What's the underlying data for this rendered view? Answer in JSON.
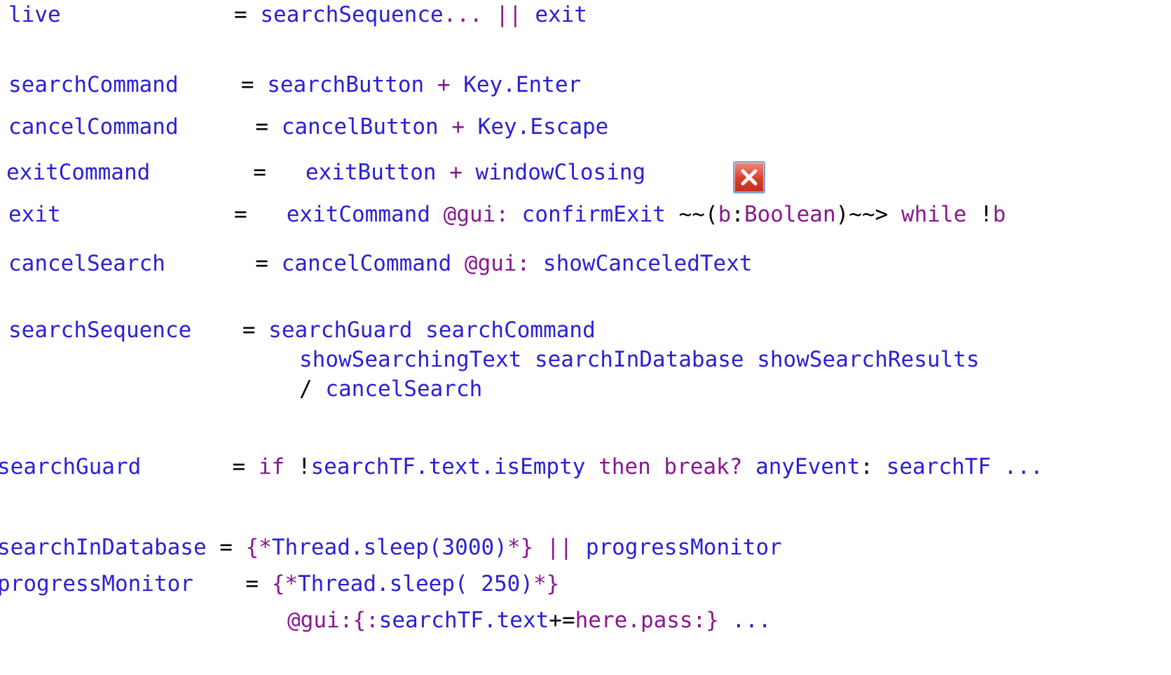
{
  "code_lines": [
    [
      {
        "t": "live",
        "k": "id"
      },
      {
        "t": "= ",
        "k": "op"
      },
      {
        "t": "searchSequence",
        "k": "id"
      },
      {
        "t": "...",
        "k": "kw"
      },
      {
        "t": " || ",
        "k": "kw"
      },
      {
        "t": "exit",
        "k": "id"
      }
    ],
    [
      {
        "t": "searchCommand",
        "k": "id"
      },
      {
        "t": "= ",
        "k": "op"
      },
      {
        "t": "searchButton",
        "k": "id"
      },
      {
        "t": " + ",
        "k": "kw"
      },
      {
        "t": "Key.Enter",
        "k": "id"
      }
    ],
    [
      {
        "t": "cancelCommand",
        "k": "id"
      },
      {
        "t": "= ",
        "k": "op"
      },
      {
        "t": "cancelButton",
        "k": "id"
      },
      {
        "t": " + ",
        "k": "kw"
      },
      {
        "t": "Key.Escape",
        "k": "id"
      }
    ],
    [
      {
        "t": "exitCommand",
        "k": "id"
      },
      {
        "t": "=   ",
        "k": "op"
      },
      {
        "t": "exitButton",
        "k": "id"
      },
      {
        "t": " + ",
        "k": "kw"
      },
      {
        "t": "windowClosing",
        "k": "id"
      }
    ],
    [
      {
        "t": "exit",
        "k": "id"
      },
      {
        "t": "=   ",
        "k": "op"
      },
      {
        "t": "exitCommand",
        "k": "id"
      },
      {
        "t": " @gui",
        "k": "kw"
      },
      {
        "t": ": ",
        "k": "kw"
      },
      {
        "t": "confirmExit",
        "k": "id"
      },
      {
        "t": " ~~(",
        "k": "op"
      },
      {
        "t": "b",
        "k": "kw"
      },
      {
        "t": ":",
        "k": "op"
      },
      {
        "t": "Boolean",
        "k": "kw"
      },
      {
        "t": ")~~> ",
        "k": "op"
      },
      {
        "t": "while",
        "k": "kw"
      },
      {
        "t": " !",
        "k": "op"
      },
      {
        "t": "b",
        "k": "kw"
      }
    ],
    [
      {
        "t": "cancelSearch",
        "k": "id"
      },
      {
        "t": "= ",
        "k": "op"
      },
      {
        "t": "cancelCommand",
        "k": "id"
      },
      {
        "t": " @gui",
        "k": "kw"
      },
      {
        "t": ": ",
        "k": "kw"
      },
      {
        "t": "showCanceledText",
        "k": "id"
      }
    ],
    [
      {
        "t": "searchSequence",
        "k": "id"
      },
      {
        "t": "= ",
        "k": "op"
      },
      {
        "t": "searchGuard searchCommand",
        "k": "id"
      }
    ],
    [
      {
        "t": "showSearchingText searchInDatabase showSearchResults",
        "k": "id"
      }
    ],
    [
      {
        "t": "/ ",
        "k": "op"
      },
      {
        "t": "cancelSearch",
        "k": "id"
      }
    ],
    [
      {
        "t": "searchGuard",
        "k": "id"
      },
      {
        "t": "= ",
        "k": "op"
      },
      {
        "t": "if",
        "k": "kw"
      },
      {
        "t": " !",
        "k": "op"
      },
      {
        "t": "searchTF.text.isEmpty",
        "k": "id"
      },
      {
        "t": " then break? ",
        "k": "kw"
      },
      {
        "t": "anyEvent",
        "k": "id"
      },
      {
        "t": ": ",
        "k": "op"
      },
      {
        "t": "searchTF",
        "k": "id"
      },
      {
        "t": " ...",
        "k": "id"
      }
    ],
    [
      {
        "t": "searchInDatabase",
        "k": "id"
      },
      {
        "t": "= ",
        "k": "op"
      },
      {
        "t": "{*",
        "k": "kw"
      },
      {
        "t": "Thread.sleep(3000)",
        "k": "id"
      },
      {
        "t": "*}",
        "k": "kw"
      },
      {
        "t": " || ",
        "k": "kw"
      },
      {
        "t": "progressMonitor",
        "k": "id"
      }
    ],
    [
      {
        "t": "progressMonitor",
        "k": "id"
      },
      {
        "t": "= ",
        "k": "op"
      },
      {
        "t": "{*",
        "k": "kw"
      },
      {
        "t": "Thread.sleep( 250)",
        "k": "id"
      },
      {
        "t": "*}",
        "k": "kw"
      }
    ],
    [
      {
        "t": "@gui:{:",
        "k": "kw"
      },
      {
        "t": "searchTF.text",
        "k": "id"
      },
      {
        "t": "+=",
        "k": "op"
      },
      {
        "t": "here.pass",
        "k": "kw"
      },
      {
        "t": ":} ",
        "k": "kw"
      },
      {
        "t": "...",
        "k": "id"
      }
    ]
  ],
  "icons": {
    "close": "close-icon",
    "close_color": "#dc3d2a"
  },
  "colors": {
    "identifier": "#2a1fd6",
    "keyword": "#8a1690",
    "operator": "#000000"
  }
}
